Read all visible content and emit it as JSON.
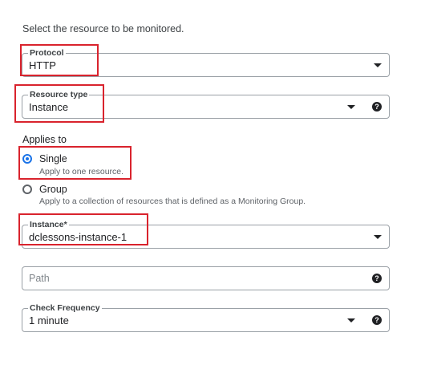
{
  "intro_text": "Select the resource to be monitored.",
  "protocol": {
    "label": "Protocol",
    "value": "HTTP"
  },
  "resource_type": {
    "label": "Resource type",
    "value": "Instance"
  },
  "applies_to": {
    "heading": "Applies to",
    "options": [
      {
        "label": "Single",
        "description": "Apply to one resource.",
        "selected": true
      },
      {
        "label": "Group",
        "description": "Apply to a collection of resources that is defined as a Monitoring Group.",
        "selected": false
      }
    ]
  },
  "instance": {
    "label": "Instance*",
    "value": "dclessons-instance-1"
  },
  "path": {
    "placeholder": "Path"
  },
  "check_frequency": {
    "label": "Check Frequency",
    "value": "1 minute"
  },
  "icons": {
    "dropdown": "caret-down-icon",
    "help": "help-icon"
  },
  "colors": {
    "highlight": "#d9232d",
    "radio_selected": "#1a73e8",
    "border": "#9aa0a6"
  }
}
